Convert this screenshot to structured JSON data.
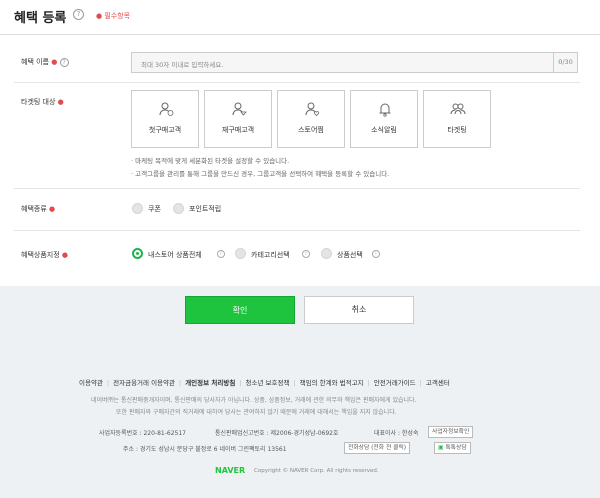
{
  "header": {
    "title": "혜택 등록",
    "required_note": "필수항목"
  },
  "benefit_name": {
    "label": "혜택 이름",
    "placeholder": "최대 30자 이내로 입력하세요.",
    "count": "0",
    "max": "/30"
  },
  "targeting": {
    "label": "타겟팅 대상",
    "options": [
      {
        "label": "첫구매고객",
        "icon": "first-buyer-icon"
      },
      {
        "label": "재구매고객",
        "icon": "repeat-buyer-icon"
      },
      {
        "label": "스토어찜",
        "icon": "store-fav-icon"
      },
      {
        "label": "소식알림",
        "icon": "bell-icon"
      },
      {
        "label": "타겟팅",
        "icon": "group-icon"
      }
    ],
    "notes": [
      "마케팅 목적에 맞게 세분화된 타겟을 설정할 수 있습니다.",
      "고객그룹을 관리를 통해 그룹을 만드신 경우, 그룹고객을 선택하여 혜택을 등록할 수 있습니다."
    ]
  },
  "benefit_type": {
    "label": "혜택종류",
    "options": [
      "쿠폰",
      "포인트적립"
    ]
  },
  "benefit_product": {
    "label": "혜택상품지정",
    "options": [
      "내스토어 상품전체",
      "카테고리선택",
      "상품선택"
    ],
    "selected": "내스토어 상품전체"
  },
  "buttons": {
    "confirm": "확인",
    "cancel": "취소"
  },
  "footer": {
    "links": [
      "이용약관",
      "전자금융거래 이용약관",
      "개인정보 처리방침",
      "청소년 보호정책",
      "책임의 한계와 법적고지",
      "안전거래가이드",
      "고객센터"
    ],
    "notice1": "네이버㈜는 통신판매중개자이며, 통신판매의 당사자가 아닙니다. 상품, 상품정보, 거래에 관한 의무와 책임은 판매자에게 있습니다.",
    "notice2": "또한 판매자와 구매자간의 직거래에 대하여 당사는 관여하지 않기 때문에 거래에 대해서는 책임을 지지 않습니다.",
    "biz_no": "사업자등록번호 : 220-81-62517",
    "mail_order_no": "통신판매업신고번호 : 제2006-경기성남-0692호",
    "ceo": "대표이사 : 한성숙",
    "biz_info_button": "사업자정보확인",
    "address": "주소 : 경기도 성남시 분당구 불정로 6 네이버 그린팩토리 13561",
    "phone_button": "전화상담 (전화 전 클릭)",
    "talk_button": "톡톡상담",
    "brand": "NAVER",
    "copyright": "Copyright © NAVER Corp. All rights reserved."
  },
  "colors": {
    "accent": "#1ec43e",
    "required": "#e24b4b"
  }
}
